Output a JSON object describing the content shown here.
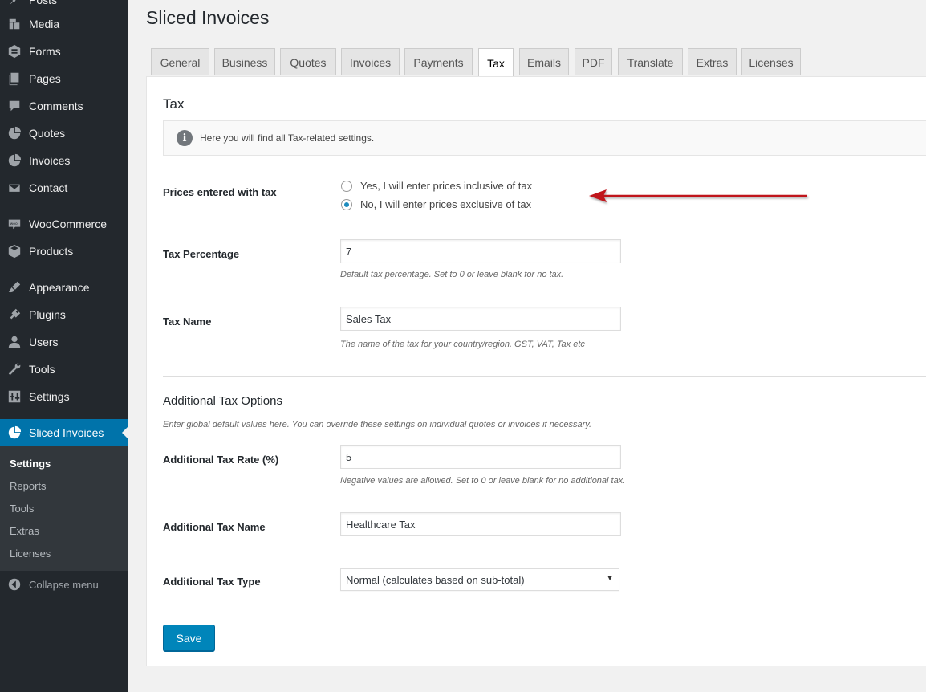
{
  "sidebar": {
    "items": [
      {
        "label": "Posts",
        "icon": "pin-icon"
      },
      {
        "label": "Media",
        "icon": "media-icon"
      },
      {
        "label": "Forms",
        "icon": "forms-icon"
      },
      {
        "label": "Pages",
        "icon": "pages-icon"
      },
      {
        "label": "Comments",
        "icon": "comment-icon"
      },
      {
        "label": "Quotes",
        "icon": "pie-icon"
      },
      {
        "label": "Invoices",
        "icon": "pie-icon"
      },
      {
        "label": "Contact",
        "icon": "mail-icon"
      },
      {
        "label": "WooCommerce",
        "icon": "woo-icon"
      },
      {
        "label": "Products",
        "icon": "box-icon"
      },
      {
        "label": "Appearance",
        "icon": "brush-icon"
      },
      {
        "label": "Plugins",
        "icon": "plug-icon"
      },
      {
        "label": "Users",
        "icon": "user-icon"
      },
      {
        "label": "Tools",
        "icon": "wrench-icon"
      },
      {
        "label": "Settings",
        "icon": "settings-icon"
      },
      {
        "label": "Sliced Invoices",
        "icon": "pie-icon",
        "active": true
      }
    ],
    "submenu": [
      "Settings",
      "Reports",
      "Tools",
      "Extras",
      "Licenses"
    ],
    "submenu_current": "Settings",
    "collapse_label": "Collapse menu"
  },
  "page_title": "Sliced Invoices",
  "tabs": [
    "General",
    "Business",
    "Quotes",
    "Invoices",
    "Payments",
    "Tax",
    "Emails",
    "PDF",
    "Translate",
    "Extras",
    "Licenses"
  ],
  "active_tab": "Tax",
  "section_title": "Tax",
  "info_text": "Here you will find all Tax-related settings.",
  "prices_with_tax": {
    "label": "Prices entered with tax",
    "options": [
      "Yes, I will enter prices inclusive of tax",
      "No, I will enter prices exclusive of tax"
    ],
    "selected_index": 1
  },
  "tax_percentage": {
    "label": "Tax Percentage",
    "value": "7",
    "desc": "Default tax percentage. Set to 0 or leave blank for no tax."
  },
  "tax_name": {
    "label": "Tax Name",
    "value": "Sales Tax",
    "desc": "The name of the tax for your country/region. GST, VAT, Tax etc"
  },
  "additional": {
    "title": "Additional Tax Options",
    "desc": "Enter global default values here. You can override these settings on individual quotes or invoices if necessary.",
    "rate": {
      "label": "Additional Tax Rate (%)",
      "value": "5",
      "desc": "Negative values are allowed. Set to 0 or leave blank for no additional tax."
    },
    "name": {
      "label": "Additional Tax Name",
      "value": "Healthcare Tax"
    },
    "type": {
      "label": "Additional Tax Type",
      "value": "Normal (calculates based on sub-total)"
    }
  },
  "save_label": "Save",
  "colors": {
    "sidebar_bg": "#23282d",
    "accent": "#0073aa",
    "button": "#0085ba",
    "annotation_arrow": "#c0161c"
  }
}
